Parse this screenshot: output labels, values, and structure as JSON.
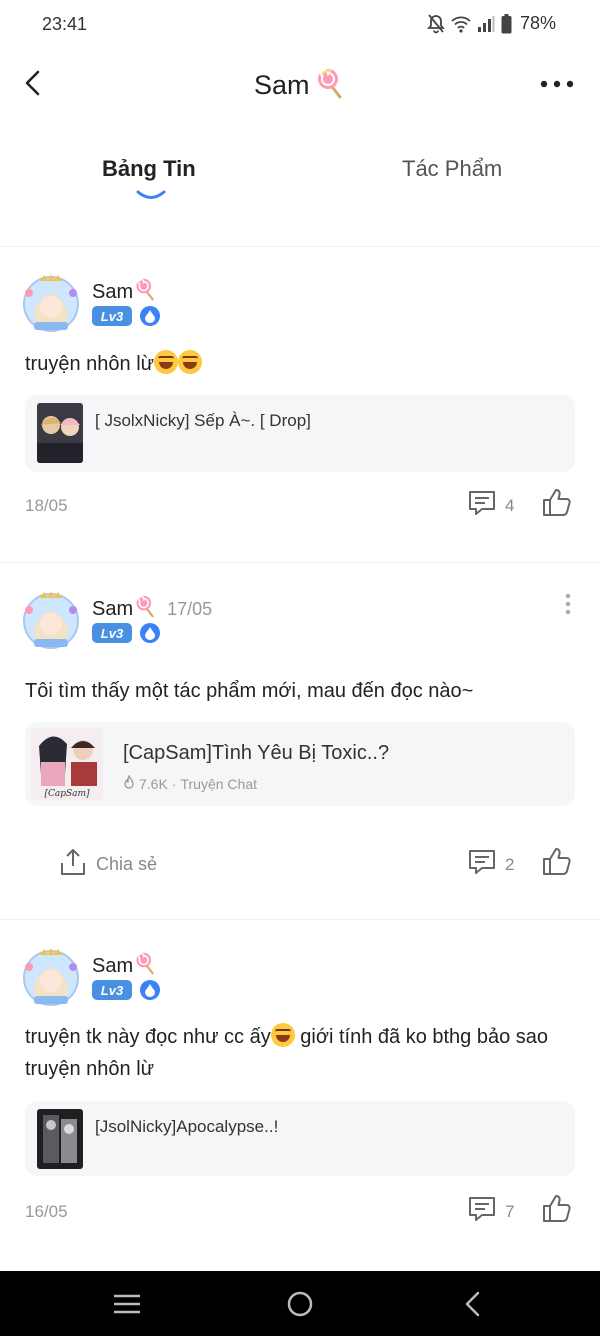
{
  "status_bar": {
    "time": "23:41",
    "battery": "78%",
    "icons": [
      "mute-bell-icon",
      "wifi-icon",
      "signal-icon",
      "battery-icon"
    ]
  },
  "header": {
    "title": "Sam",
    "title_emoji": "lollipop-icon",
    "back_icon": "back-arrow-icon",
    "more_icon": "more-dots-icon"
  },
  "tabs": [
    {
      "label": "Bảng Tin",
      "active": true
    },
    {
      "label": "Tác Phẩm",
      "active": false
    }
  ],
  "posts": [
    {
      "author": "Sam",
      "level": "Lv3",
      "inline_date": "",
      "text": "truyện nhôn lừ",
      "text_emoji_count": 2,
      "story_title": "[ JsolxNicky] Sếp À~. [ Drop]",
      "date": "18/05",
      "comments": "4"
    },
    {
      "author": "Sam",
      "level": "Lv3",
      "inline_date": "17/05",
      "text": "Tôi tìm thấy một tác phẩm mới, mau đến đọc nào~",
      "story_title": "[CapSam]Tình Yêu Bị Toxic..?",
      "story_views": "7.6K",
      "story_type": "Truyện Chat",
      "share_label": "Chia sẻ",
      "comments": "2"
    },
    {
      "author": "Sam",
      "level": "Lv3",
      "inline_date": "",
      "text_part1": "truyện tk này đọc như cc ấy",
      "text_part2": " giới tính đã ko bthg bảo sao truyện nhôn lừ",
      "story_title": "[JsolNicky]Apocalypse..!",
      "date": "16/05",
      "comments": "7"
    }
  ],
  "nav_bar": {
    "icons": [
      "recent-apps-icon",
      "home-icon",
      "back-icon"
    ]
  },
  "colors": {
    "accent": "#4a90e2",
    "tab_indicator": "#3b82f6",
    "muted_text": "#999999"
  }
}
